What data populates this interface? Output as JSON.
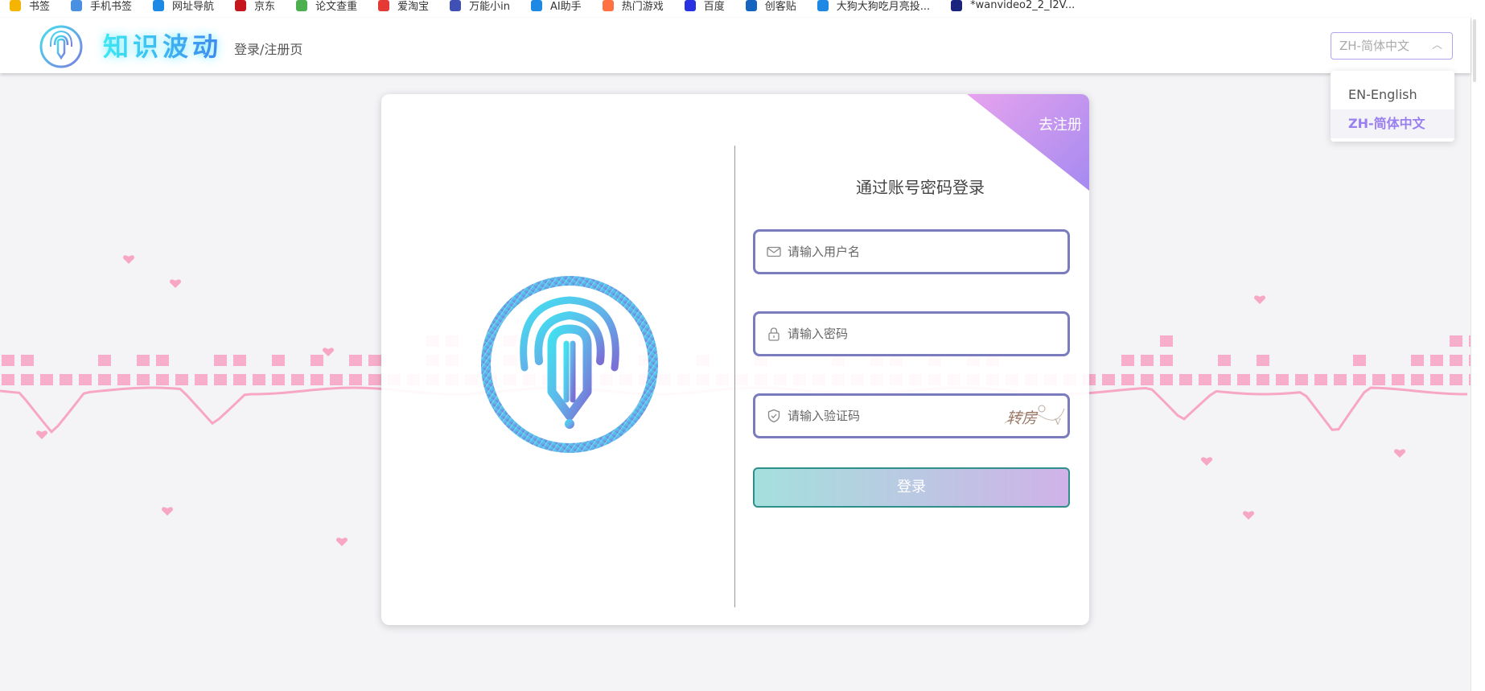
{
  "bookmarks": [
    {
      "label": "书签",
      "icon": "star-icon",
      "color": "#f5b400"
    },
    {
      "label": "手机书签",
      "icon": "phone-icon",
      "color": "#4a90e2"
    },
    {
      "label": "网址导航",
      "icon": "ie-icon",
      "color": "#1e88e5"
    },
    {
      "label": "京东",
      "icon": "jd-icon",
      "color": "#c4161c"
    },
    {
      "label": "论文查重",
      "icon": "pp-icon",
      "color": "#4caf50"
    },
    {
      "label": "爱淘宝",
      "icon": "taobao-icon",
      "color": "#e53935"
    },
    {
      "label": "万能小in",
      "icon": "robot-icon",
      "color": "#3f51b5"
    },
    {
      "label": "AI助手",
      "icon": "ie-icon",
      "color": "#1e88e5"
    },
    {
      "label": "热门游戏",
      "icon": "game-icon",
      "color": "#ff7043"
    },
    {
      "label": "百度",
      "icon": "baidu-icon",
      "color": "#2932e1"
    },
    {
      "label": "创客贴",
      "icon": "dropbox-icon",
      "color": "#1565c0"
    },
    {
      "label": "大狗大狗吃月亮投...",
      "icon": "tv-icon",
      "color": "#1e88e5"
    },
    {
      "label": "*wanvideo2_2_I2V...",
      "icon": "c-icon",
      "color": "#1a237e"
    }
  ],
  "header": {
    "brand": "知识波动",
    "page_label": "登录/注册页",
    "language": {
      "selected": "ZH-简体中文",
      "options": [
        {
          "label": "EN-English",
          "active": false
        },
        {
          "label": "ZH-简体中文",
          "active": true
        }
      ]
    }
  },
  "card": {
    "corner_label": "去注册",
    "title": "通过账号密码登录",
    "username_placeholder": "请输入用户名",
    "password_placeholder": "请输入密码",
    "captcha_placeholder": "请输入验证码",
    "captcha_text": "转房",
    "login_label": "登录"
  },
  "colors": {
    "accent": "#9a7ff0",
    "field_border": "#7a7cbe",
    "visualizer": "#f7a6c4"
  }
}
